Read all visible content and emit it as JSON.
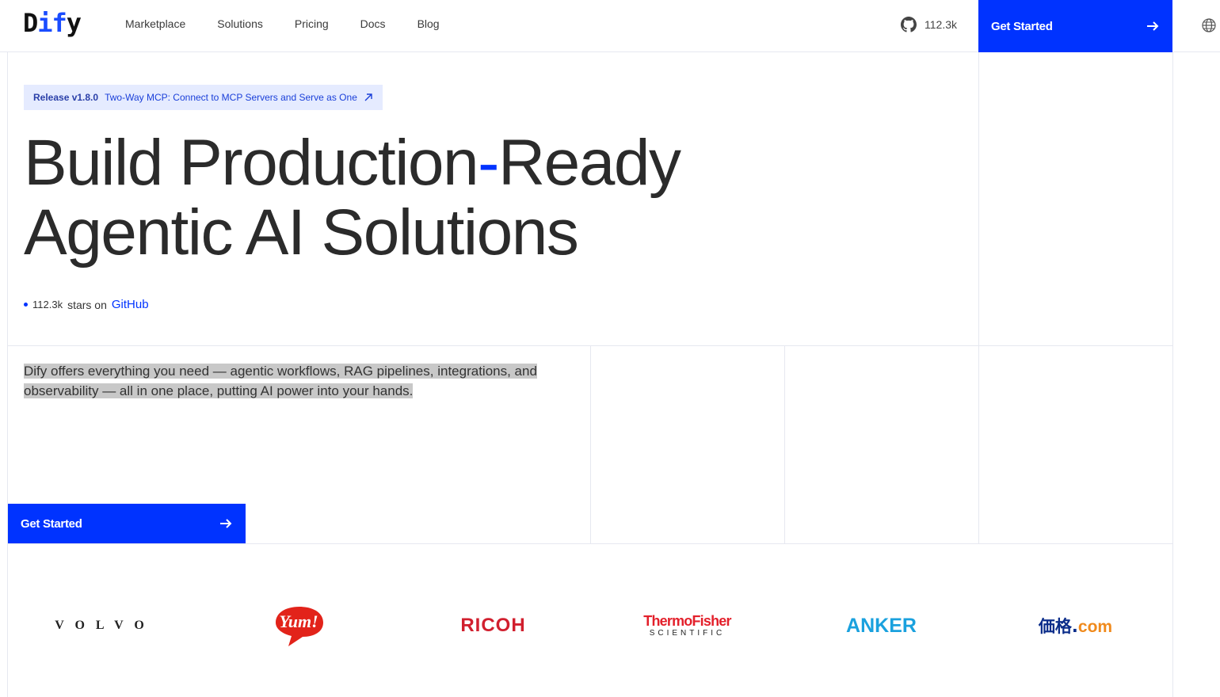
{
  "header": {
    "logo_prefix": "D",
    "logo_mid": "if",
    "logo_suffix": "y",
    "nav": [
      "Marketplace",
      "Solutions",
      "Pricing",
      "Docs",
      "Blog"
    ],
    "github_count": "112.3k",
    "cta_label": "Get Started"
  },
  "hero": {
    "release_version": "Release v1.8.0",
    "release_text": "Two-Way MCP: Connect to MCP Servers and Serve as One",
    "headline_line1_a": "Build Production",
    "headline_line1_dash": "-",
    "headline_line1_b": "Ready",
    "headline_line2": "Agentic AI Solutions",
    "stars_count": "112.3k",
    "stars_text": "stars on",
    "stars_link": "GitHub",
    "description": "Dify offers everything you need — agentic workflows, RAG pipelines, integrations, and observability — all in one place, putting AI power into your hands.",
    "cta_label": "Get Started"
  },
  "logos": {
    "volvo": "VOLVO",
    "yum": "Yum!",
    "ricoh": "RICOH",
    "thermo_top": "ThermoFisher",
    "thermo_bottom": "SCIENTIFIC",
    "anker": "ANKER",
    "kakaku_main": "価格",
    "kakaku_dot": ".",
    "kakaku_com": "com"
  },
  "colors": {
    "accent": "#0033ff",
    "badge_bg": "#e5ebff",
    "highlight": "#c8c8c8"
  },
  "icons": [
    "github-icon",
    "arrow-right-icon",
    "globe-icon",
    "arrow-up-right-icon"
  ]
}
